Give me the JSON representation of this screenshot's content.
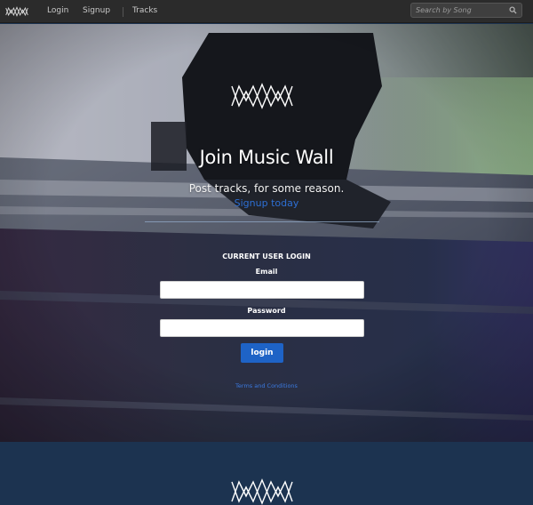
{
  "nav": {
    "logo_icon": "music-wall-zigzag-logo",
    "links": {
      "login": "Login",
      "signup": "Signup",
      "tracks": "Tracks"
    },
    "search": {
      "placeholder": "Search by Song",
      "value": "",
      "icon": "search-icon"
    }
  },
  "hero": {
    "logo_icon": "music-wall-zigzag-logo",
    "title": "Join Music Wall",
    "subtitle": "Post tracks, for some reason.",
    "signup_link": "Signup today"
  },
  "login": {
    "heading": "CURRENT USER LOGIN",
    "email_label": "Email",
    "email_value": "",
    "password_label": "Password",
    "password_value": "",
    "button_label": "login",
    "terms_link": "Terms and Conditions"
  },
  "footer": {
    "logo_icon": "music-wall-zigzag-logo"
  },
  "colors": {
    "navbar_bg": "#2b2b2b",
    "accent_blue": "#1e63c6",
    "link_blue": "#2d6fd4",
    "footer_bg": "#1c3350"
  }
}
